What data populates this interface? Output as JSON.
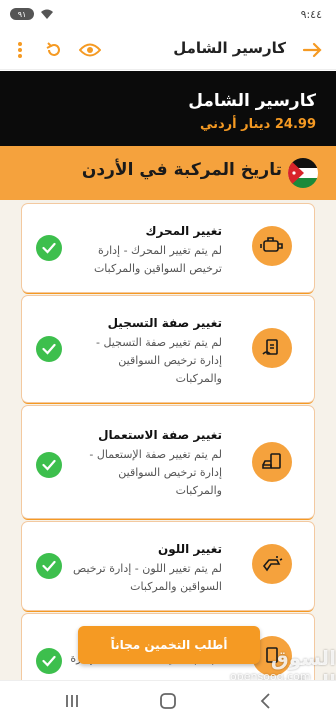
{
  "status_bar": {
    "time": "٩:٤٤",
    "battery": "٩١"
  },
  "app_bar": {
    "title": "كارسير الشامل"
  },
  "product": {
    "title": "كارسير الشامل",
    "price": "24.99 دينار أردني"
  },
  "history": {
    "title": "تاريخ المركبة في الأردن"
  },
  "cards": [
    {
      "title": "تغيير المحرك",
      "desc": "لم يتم تغيير المحرك - إدارة ترخيص السواقين والمركبات",
      "icon": "engine-icon"
    },
    {
      "title": "تغيير صفة التسجيل",
      "desc": "لم يتم تغيير صفة التسجيل - إدارة ترخيص السواقين والمركبات",
      "icon": "registration-icon"
    },
    {
      "title": "تغيير صفة الاستعمال",
      "desc": "لم يتم تغيير صفة الإستعمال - إدارة ترخيص السواقين والمركبات",
      "icon": "usage-icon"
    },
    {
      "title": "تغيير اللون",
      "desc": "لم يتم تغيير اللون - إدارة ترخيص السواقين والمركبات",
      "icon": "paint-gun-icon"
    },
    {
      "title": "",
      "desc": "لم يتم تغيير صفة التسجيل - إدارة",
      "icon": "registration-icon"
    }
  ],
  "fab": {
    "label": "أطلب التخمين مجاناً"
  },
  "watermark": {
    "arabic": "السوق المفتوح",
    "english": "opensooq.com"
  },
  "colors": {
    "accent": "#f59a23",
    "header_bg": "#0b0b0b",
    "check": "#3dbf4d"
  }
}
